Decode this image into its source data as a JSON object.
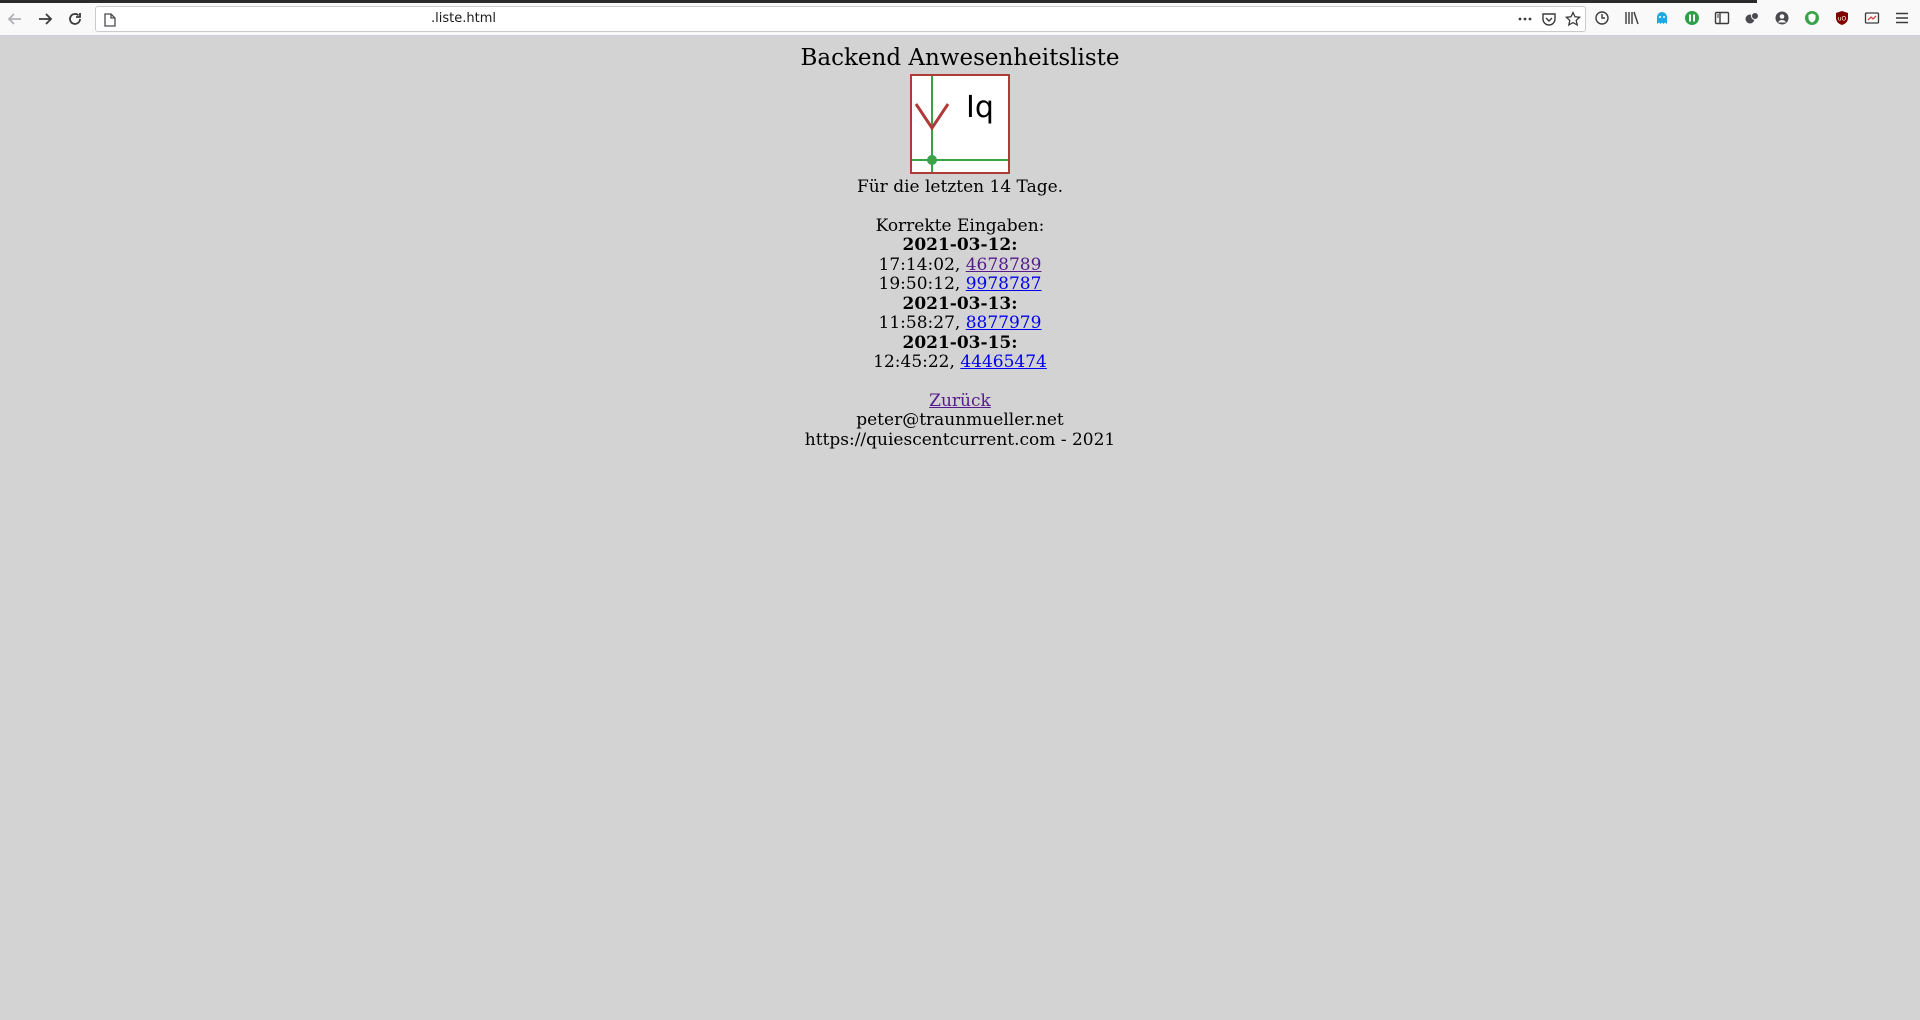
{
  "browser": {
    "url": ".liste.html"
  },
  "page": {
    "title": "Backend Anwesenheitsliste",
    "logo_text": "Iq",
    "subtitle": "Für die letzten 14 Tage.",
    "section_label": "Korrekte Eingaben:",
    "days": [
      {
        "date": "2021-03-12:",
        "entries": [
          {
            "time": "17:14:02, ",
            "id": "4678789"
          },
          {
            "time": "19:50:12, ",
            "id": "9978787"
          }
        ]
      },
      {
        "date": "2021-03-13:",
        "entries": [
          {
            "time": "11:58:27, ",
            "id": "8877979"
          }
        ]
      },
      {
        "date": "2021-03-15:",
        "entries": [
          {
            "time": "12:45:22, ",
            "id": "44465474"
          }
        ]
      }
    ],
    "back_link": "Zurück",
    "email": "peter@traunmueller.net",
    "footer": "https://quiescentcurrent.com - 2021"
  },
  "colors": {
    "page_bg": "#d3d3d3",
    "link": "#0000ee",
    "link_visited": "#551a8b",
    "logo_border": "#b03a3a",
    "logo_green": "#3aa34a"
  }
}
